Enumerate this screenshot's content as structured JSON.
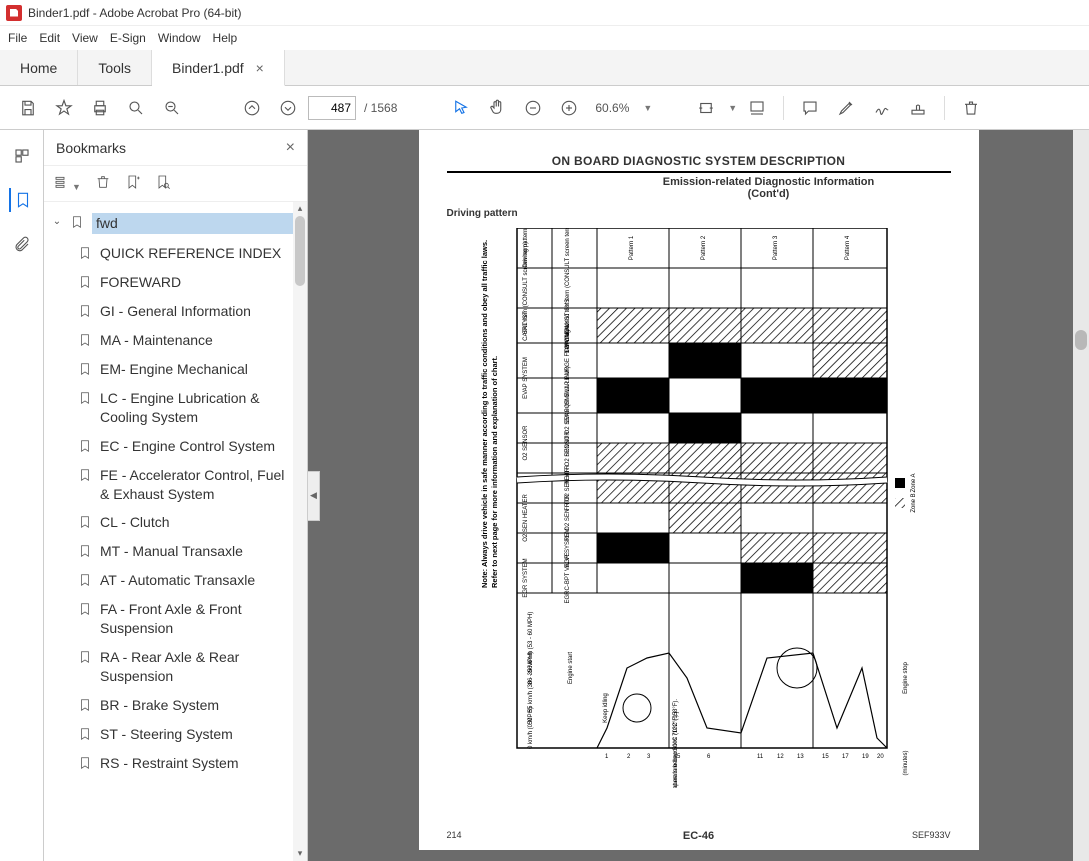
{
  "window": {
    "title": "Binder1.pdf - Adobe Acrobat Pro (64-bit)"
  },
  "menu": [
    "File",
    "Edit",
    "View",
    "E-Sign",
    "Window",
    "Help"
  ],
  "tabs": {
    "home": "Home",
    "tools": "Tools",
    "doc": "Binder1.pdf"
  },
  "toolbar": {
    "page_current": "487",
    "page_total": "/ 1568",
    "zoom": "60.6%"
  },
  "bookmarks": {
    "title": "Bookmarks",
    "root": "fwd",
    "items": [
      "QUICK REFERENCE INDEX",
      "FOREWARD",
      "GI - General Information",
      "MA - Maintenance",
      "EM- Engine Mechanical",
      "LC - Engine Lubrication & Cooling System",
      "EC - Engine Control System",
      "FE - Accelerator Control, Fuel & Exhaust System",
      "CL - Clutch",
      "MT - Manual Transaxle",
      "AT - Automatic Transaxle",
      "FA - Front Axle & Front Suspension",
      "RA - Rear Axle & Rear Suspension",
      "BR - Brake System",
      "ST - Steering System",
      "RS - Restraint System"
    ]
  },
  "document": {
    "title_main": "ON BOARD DIAGNOSTIC SYSTEM DESCRIPTION",
    "subtitle": "Emission-related Diagnostic Information",
    "contd": "(Cont'd)",
    "section": "Driving pattern",
    "note": "Note: Always drive vehicle in safe manner according to traffic conditions and obey all traffic laws.",
    "note2": "Refer to next page for more information and explanation of chart.",
    "page_left": "214",
    "page_center": "EC-46",
    "page_right": "SEF933V",
    "chart": {
      "row_header": "Driving pattern",
      "rows": [
        "SRT Item (CONSULT screen term)",
        "CATALYST",
        "EVAP SYSTEM",
        "O2 SENSOR",
        "O2 SEN HEATER",
        "EGR SYSTEM"
      ],
      "subrows": [
        "Self-diagnostic test item (CONSULT screen term)",
        "TW CATALYST SYS",
        "EVAP PURGE FLOW/MON",
        "EVAP (SMALL LEAK)",
        "FRONT O2 SENSOR",
        "REAR O2 SENSOR",
        "FR O2 SEN HTR",
        "RR O2 SEN HTR",
        "EGR SYSTEM",
        "EGRC-BPT VALVE"
      ],
      "columns": [
        "Pattern 1",
        "Pattern 2",
        "Pattern 3",
        "Pattern 4"
      ],
      "legend": {
        "zone_a": "Zone A",
        "zone_b": "Zone B"
      },
      "y_axis": {
        "engine_start": "Engine start",
        "keep_idling": "Keep idling",
        "speed1": "86 - 96 km/h (53 - 60 MPH)",
        "speed2": "50 - 55 km/h (30 - 35 MPH)",
        "speed3": "0 km/h (0 MPH)",
        "temp1": "Engine coolant temperature becomes 70°C (158°F).",
        "temp2": "[Engine coolant temperature is below 50°C (122°F).]",
        "engine_stop": "Engine stop",
        "minutes": "(minutes)"
      }
    }
  }
}
